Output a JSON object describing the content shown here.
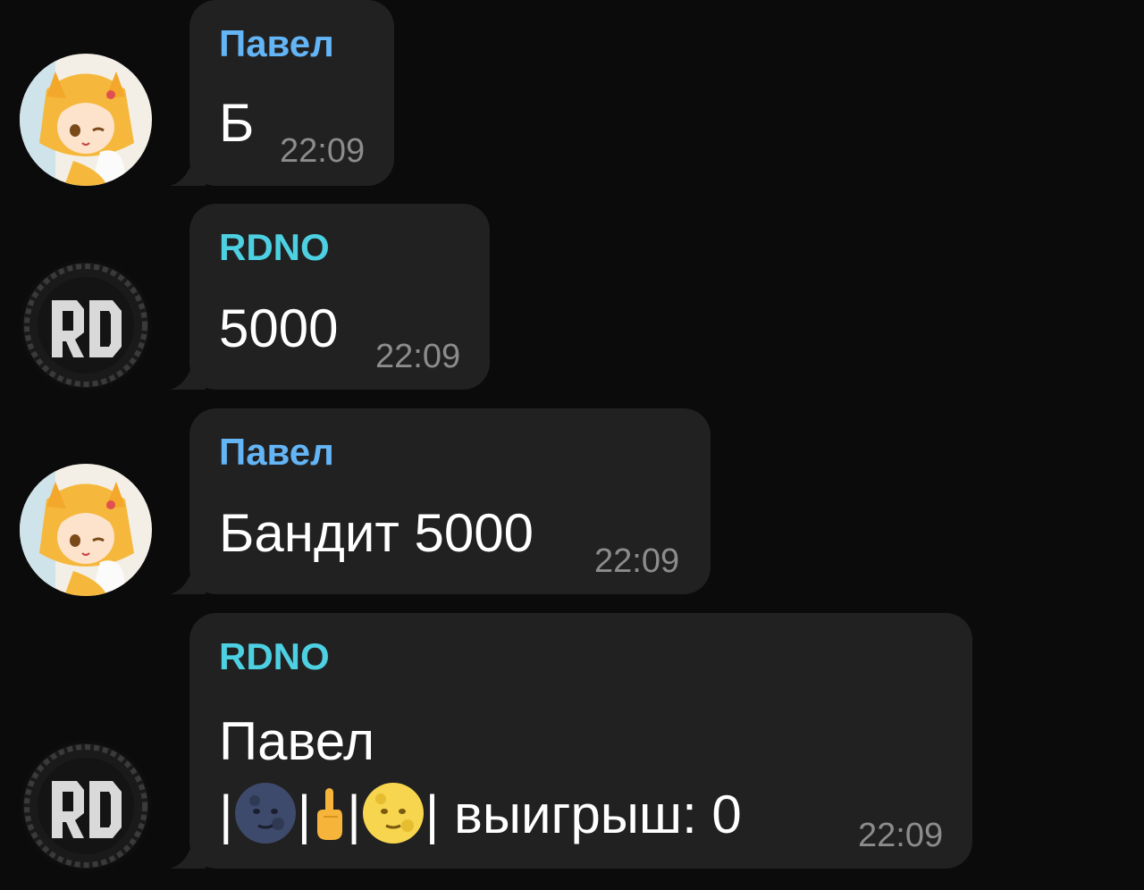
{
  "messages": [
    {
      "sender": "Павел",
      "text": "Б",
      "time": "22:09"
    },
    {
      "sender": "RDNO",
      "text": "5000",
      "time": "22:09"
    },
    {
      "sender": "Павел",
      "text": "Бандит 5000",
      "time": "22:09"
    },
    {
      "sender": "RDNO",
      "text_line1": "Павел",
      "slot_sep": "|",
      "winnings_text": "| выигрыш: 0",
      "time": "22:09"
    }
  ],
  "colors": {
    "background": "#0b0b0b",
    "bubble": "#212121",
    "sender_pavel": "#64b5f6",
    "sender_rdno": "#4dd0e1",
    "time": "#8c8c8c"
  },
  "icons": {
    "pavel_avatar": "anime-fox-girl-avatar",
    "rdno_avatar": "rd-logo-avatar",
    "slot_1": "new-moon-face-emoji",
    "slot_2": "middle-finger-emoji",
    "slot_3": "full-moon-face-emoji"
  }
}
